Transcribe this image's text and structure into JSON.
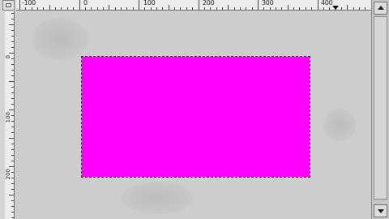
{
  "ruler_h": {
    "labels": [
      "-100",
      "0",
      "100",
      "200",
      "300",
      "400"
    ]
  },
  "ruler_v": {
    "labels": [
      "0",
      "100",
      "200"
    ]
  },
  "canvas": {
    "fill_color": "#ff00ff",
    "selection": "marching-ants"
  },
  "icons": {
    "corner": "view-menu-icon",
    "scroll_up": "arrow-up-icon",
    "scroll_down": "arrow-down-icon",
    "ruler_marker": "pointer-triangle-icon"
  }
}
